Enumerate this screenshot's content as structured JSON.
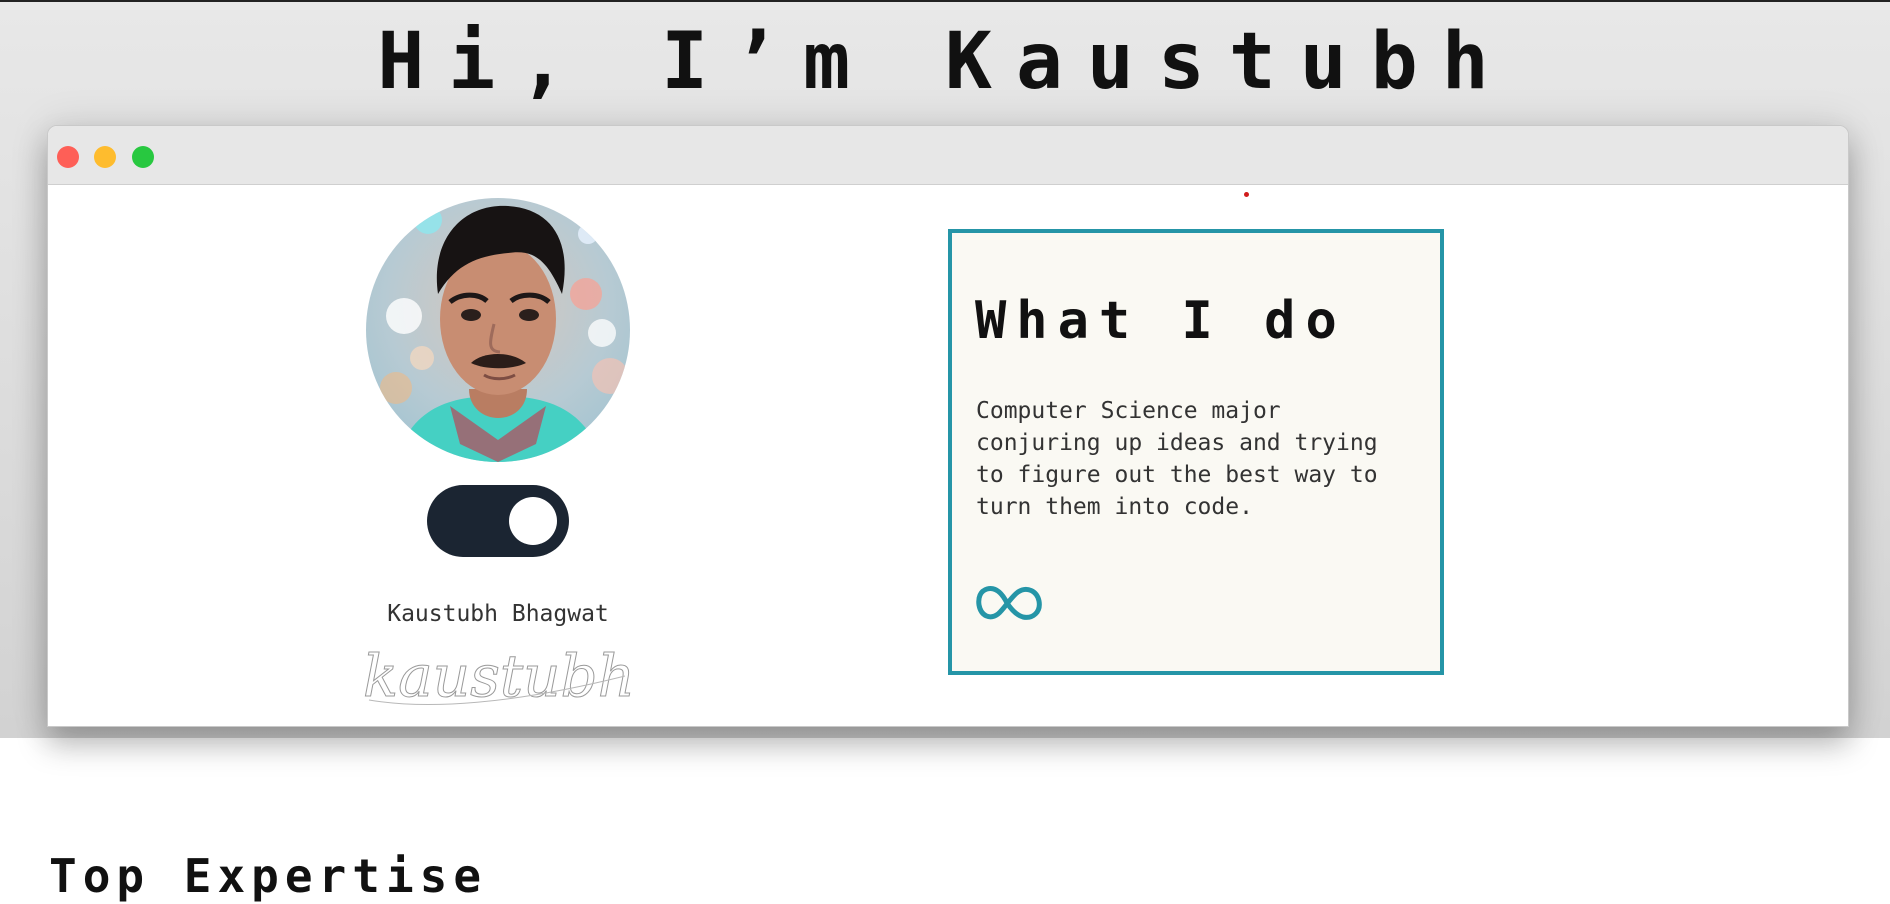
{
  "hero": {
    "title": "Hi, I’m Kaustubh"
  },
  "window": {
    "controls": [
      "close",
      "minimize",
      "maximize"
    ]
  },
  "profile": {
    "name": "Kaustubh Bhagwat",
    "signature": "kaustubh",
    "theme_toggle_on": true
  },
  "card": {
    "title": "What I do",
    "description": "Computer Science major conjuring up ideas and trying to figure out the best way to turn them into code.",
    "icon": "infinity-icon"
  },
  "expertise": {
    "title": "Top Expertise"
  },
  "colors": {
    "accent": "#2595a7",
    "toggle": "#1b2532",
    "close": "#fe5f57",
    "minimize": "#febc2e",
    "maximize": "#28c840"
  }
}
